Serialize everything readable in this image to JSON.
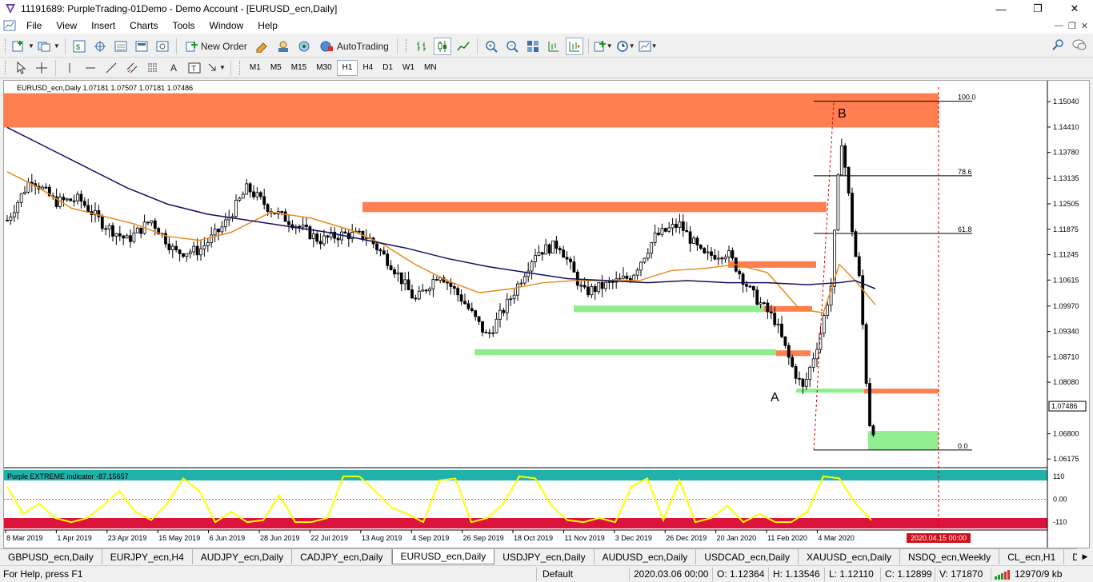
{
  "window": {
    "title": "11191689: PurpleTrading-01Demo - Demo Account - [EURUSD_ecn,Daily]"
  },
  "menu": [
    "File",
    "View",
    "Insert",
    "Charts",
    "Tools",
    "Window",
    "Help"
  ],
  "toolbar": {
    "new_order": "New Order",
    "autotrading": "AutoTrading"
  },
  "timeframes": [
    "M1",
    "M5",
    "M15",
    "M30",
    "H1",
    "H4",
    "D1",
    "W1",
    "MN"
  ],
  "active_timeframe": "H1",
  "chart": {
    "header": "EURUSD_ecn,Daily  1.07181 1.07507 1.07181 1.07486",
    "current_price": "1.07486",
    "price_ticks": [
      "1.15040",
      "1.14410",
      "1.13780",
      "1.13135",
      "1.12505",
      "1.11875",
      "1.11245",
      "1.10615",
      "1.09970",
      "1.09340",
      "1.08710",
      "1.08080",
      "1.07486",
      "1.06800",
      "1.06175"
    ],
    "date_ticks": [
      "8 Mar 2019",
      "1 Apr 2019",
      "23 Apr 2019",
      "15 May 2019",
      "6 Jun 2019",
      "28 Jun 2019",
      "22 Jul 2019",
      "13 Aug 2019",
      "4 Sep 2019",
      "26 Sep 2019",
      "18 Oct 2019",
      "11 Nov 2019",
      "3 Dec 2019",
      "26 Dec 2019",
      "20 Jan 2020",
      "11 Feb 2020",
      "4 Mar 2020"
    ],
    "date_marker": "2020.04.15 00:00",
    "fib_levels": [
      "100.0",
      "78.6",
      "61.8",
      "0.0"
    ],
    "point_a": "A",
    "point_b": "B",
    "colors": {
      "supply": "#ff7f50",
      "demand": "#90ee90",
      "ma_fast": "#e98b1c",
      "ma_slow": "#101060",
      "indicator_line": "#ffff00",
      "indicator_top": "#20b2aa",
      "indicator_bottom": "#dc143c"
    }
  },
  "chart_data": {
    "type": "candlestick",
    "series": [
      {
        "values": [
          [
            0,
            1.121
          ],
          [
            30,
            1.1315
          ],
          [
            60,
            1.1255
          ],
          [
            90,
            1.1262
          ],
          [
            120,
            1.12
          ],
          [
            150,
            1.116
          ],
          [
            180,
            1.121
          ],
          [
            210,
            1.113
          ],
          [
            240,
            1.1135
          ],
          [
            270,
            1.1195
          ],
          [
            300,
            1.129
          ],
          [
            330,
            1.1235
          ],
          [
            360,
            1.12
          ],
          [
            390,
            1.116
          ],
          [
            420,
            1.1175
          ],
          [
            450,
            1.117
          ],
          [
            480,
            1.11
          ],
          [
            510,
            1.101
          ],
          [
            540,
            1.108
          ],
          [
            570,
            1.101
          ],
          [
            600,
            1.092
          ],
          [
            630,
            1.102
          ],
          [
            660,
            1.113
          ],
          [
            690,
            1.115
          ],
          [
            720,
            1.103
          ],
          [
            750,
            1.105
          ],
          [
            780,
            1.107
          ],
          [
            810,
            1.117
          ],
          [
            840,
            1.12
          ],
          [
            870,
            1.112
          ],
          [
            900,
            1.113
          ],
          [
            930,
            1.103
          ],
          [
            960,
            1.096
          ],
          [
            980,
            1.085
          ],
          [
            995,
            1.079
          ],
          [
            1015,
            1.092
          ],
          [
            1030,
            1.105
          ],
          [
            1042,
            1.142
          ],
          [
            1050,
            1.13
          ],
          [
            1058,
            1.115
          ],
          [
            1066,
            1.105
          ],
          [
            1074,
            1.08
          ],
          [
            1080,
            1.066
          ],
          [
            1087,
            1.075
          ]
        ]
      },
      {
        "values": [
          [
            0,
            1.133
          ],
          [
            40,
            1.129
          ],
          [
            80,
            1.124
          ],
          [
            120,
            1.122
          ],
          [
            160,
            1.12
          ],
          [
            200,
            1.117
          ],
          [
            240,
            1.116
          ],
          [
            280,
            1.118
          ],
          [
            330,
            1.123
          ],
          [
            380,
            1.1215
          ],
          [
            430,
            1.1185
          ],
          [
            470,
            1.115
          ],
          [
            510,
            1.11
          ],
          [
            550,
            1.106
          ],
          [
            590,
            1.103
          ],
          [
            630,
            1.104
          ],
          [
            670,
            1.1055
          ],
          [
            710,
            1.106
          ],
          [
            750,
            1.106
          ],
          [
            790,
            1.106
          ],
          [
            830,
            1.1085
          ],
          [
            870,
            1.109
          ],
          [
            910,
            1.11
          ],
          [
            950,
            1.108
          ],
          [
            990,
            1.099
          ],
          [
            1020,
            1.098
          ],
          [
            1040,
            1.11
          ],
          [
            1060,
            1.106
          ],
          [
            1085,
            1.1
          ]
        ]
      },
      {
        "values": [
          [
            0,
            1.144
          ],
          [
            50,
            1.139
          ],
          [
            100,
            1.134
          ],
          [
            150,
            1.129
          ],
          [
            200,
            1.125
          ],
          [
            250,
            1.1225
          ],
          [
            300,
            1.121
          ],
          [
            350,
            1.1195
          ],
          [
            400,
            1.118
          ],
          [
            450,
            1.116
          ],
          [
            500,
            1.114
          ],
          [
            550,
            1.1115
          ],
          [
            600,
            1.1095
          ],
          [
            650,
            1.108
          ],
          [
            700,
            1.1065
          ],
          [
            750,
            1.106
          ],
          [
            800,
            1.1055
          ],
          [
            850,
            1.106
          ],
          [
            900,
            1.1055
          ],
          [
            950,
            1.1055
          ],
          [
            1000,
            1.105
          ],
          [
            1040,
            1.1055
          ],
          [
            1060,
            1.106
          ],
          [
            1085,
            1.104
          ]
        ]
      }
    ],
    "indicator": {
      "name": "Purple EXTREME indicator",
      "value": -87.15657,
      "levels": [
        110,
        0,
        -110
      ]
    },
    "yrange": [
      1.06,
      1.154
    ]
  },
  "tabs": [
    "GBPUSD_ecn,Daily",
    "EURJPY_ecn,H4",
    "AUDJPY_ecn,Daily",
    "CADJPY_ecn,Daily",
    "EURUSD_ecn,Daily",
    "USDJPY_ecn,Daily",
    "AUDUSD_ecn,Daily",
    "USDCAD_ecn,Daily",
    "XAUUSD_ecn,Daily",
    "NSDQ_ecn,Weekly",
    "CL_ecn,H1",
    "DAX_ecn,W"
  ],
  "active_tab": "EURUSD_ecn,Daily",
  "status": {
    "help": "For Help, press F1",
    "profile": "Default",
    "datetime": "2020.03.06 00:00",
    "open": "O: 1.12364",
    "high": "H: 1.13546",
    "low": "L: 1.12110",
    "close": "C: 1.12899",
    "volume": "V: 171870",
    "traffic": "12970/9 kb"
  }
}
